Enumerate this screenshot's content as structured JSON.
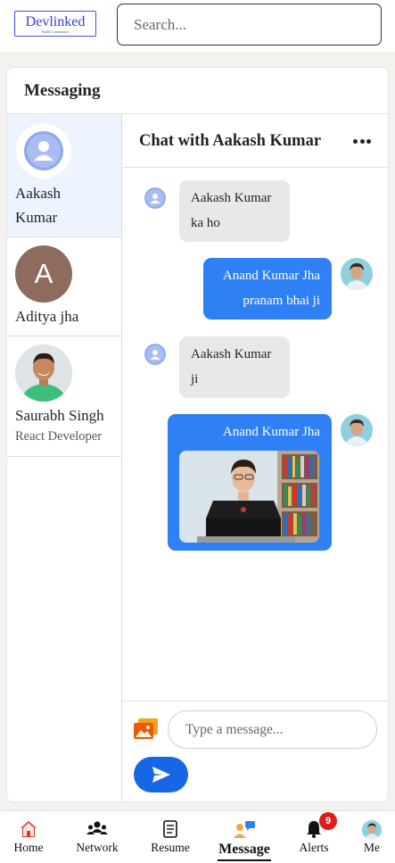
{
  "app": {
    "logo_name": "Devlinked",
    "logo_tagline": "Build Connections",
    "search_placeholder": "Search..."
  },
  "messaging": {
    "title": "Messaging"
  },
  "contacts": [
    {
      "name_line1": "Aakash",
      "name_line2": "Kumar",
      "subtitle": "",
      "active": true,
      "avatar": "default-avatar-icon"
    },
    {
      "name_line1": "Aditya jha",
      "name_line2": "",
      "subtitle": "",
      "active": false,
      "avatar_letter": "A"
    },
    {
      "name_line1": "Saurabh Singh",
      "name_line2": "",
      "subtitle": "React Developer",
      "active": false,
      "avatar": "photo"
    }
  ],
  "chat": {
    "title": "Chat with Aakash Kumar",
    "messages": [
      {
        "direction": "incoming",
        "sender": "Aakash Kumar",
        "text": "ka ho"
      },
      {
        "direction": "outgoing",
        "sender": "Anand Kumar Jha",
        "text": "pranam bhai ji"
      },
      {
        "direction": "incoming",
        "sender": "Aakash Kumar",
        "text": "ji"
      },
      {
        "direction": "outgoing",
        "sender": "Anand Kumar Jha",
        "text": "",
        "attachment": "image"
      }
    ],
    "input_placeholder": "Type a message..."
  },
  "nav": {
    "items": [
      {
        "label": "Home",
        "icon": "home-icon"
      },
      {
        "label": "Network",
        "icon": "network-icon"
      },
      {
        "label": "Resume",
        "icon": "resume-icon"
      },
      {
        "label": "Message",
        "icon": "message-icon",
        "active": true
      },
      {
        "label": "Alerts",
        "icon": "bell-icon",
        "badge": "9"
      },
      {
        "label": "Me",
        "icon": "avatar"
      }
    ]
  },
  "colors": {
    "accent_blue": "#2f80f5",
    "send_button": "#1766e6",
    "incoming_bubble": "#e8e8ea",
    "active_contact": "#eef4fd",
    "badge_red": "#e01b1b",
    "logo_blue": "#3442c9"
  }
}
